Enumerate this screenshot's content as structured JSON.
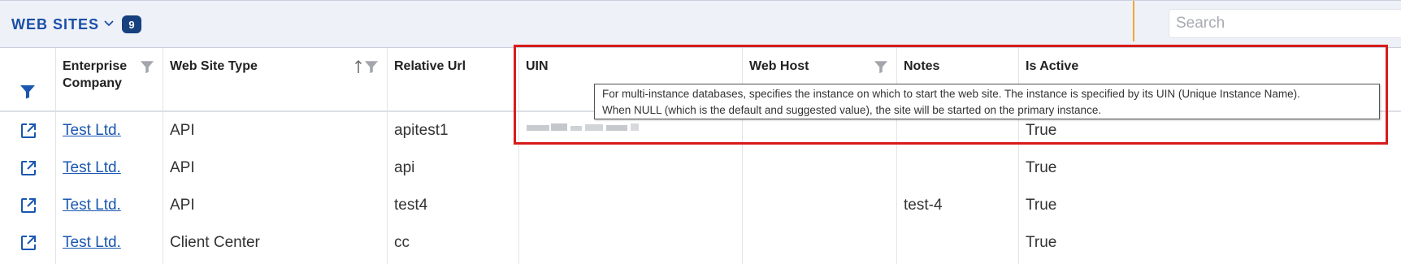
{
  "header": {
    "title": "WEB SITES",
    "count": "9",
    "search_placeholder": "Search",
    "accent": "#1a4fa6",
    "badge_color": "#17407f"
  },
  "columns": [
    {
      "key": "enterprise_company",
      "label_line1": "Enterprise",
      "label_line2": "Company"
    },
    {
      "key": "web_site_type",
      "label": "Web Site Type"
    },
    {
      "key": "relative_url",
      "label": "Relative Url"
    },
    {
      "key": "uin",
      "label": "UIN"
    },
    {
      "key": "web_host",
      "label": "Web Host"
    },
    {
      "key": "notes",
      "label": "Notes"
    },
    {
      "key": "is_active",
      "label": "Is Active"
    }
  ],
  "rows": [
    {
      "company": "Test Ltd.",
      "type": "API",
      "url": "apitest1",
      "uin": "",
      "web_host": "",
      "notes": "",
      "active": "True"
    },
    {
      "company": "Test Ltd.",
      "type": "API",
      "url": "api",
      "uin": "",
      "web_host": "",
      "notes": "",
      "active": "True"
    },
    {
      "company": "Test Ltd.",
      "type": "API",
      "url": "test4",
      "uin": "",
      "web_host": "",
      "notes": "test-4",
      "active": "True"
    },
    {
      "company": "Test Ltd.",
      "type": "Client Center",
      "url": "cc",
      "uin": "",
      "web_host": "",
      "notes": "",
      "active": "True"
    }
  ],
  "tooltip": {
    "line1": "For multi-instance databases, specifies the instance on which to start the web site. The instance is specified by its UIN (Unique Instance Name).",
    "line2": "When NULL (which is the default and suggested value), the site will be started on the primary instance."
  },
  "icons": {
    "filter": "filter-icon",
    "open": "open-external-icon",
    "chevron": "chevron-down-icon",
    "sort": "sort-ascending-icon"
  },
  "colors": {
    "highlight": "#d81b1b",
    "link": "#1a57b0",
    "filter_active": "#1a57b0",
    "filter_inactive": "#a3a6ab"
  }
}
